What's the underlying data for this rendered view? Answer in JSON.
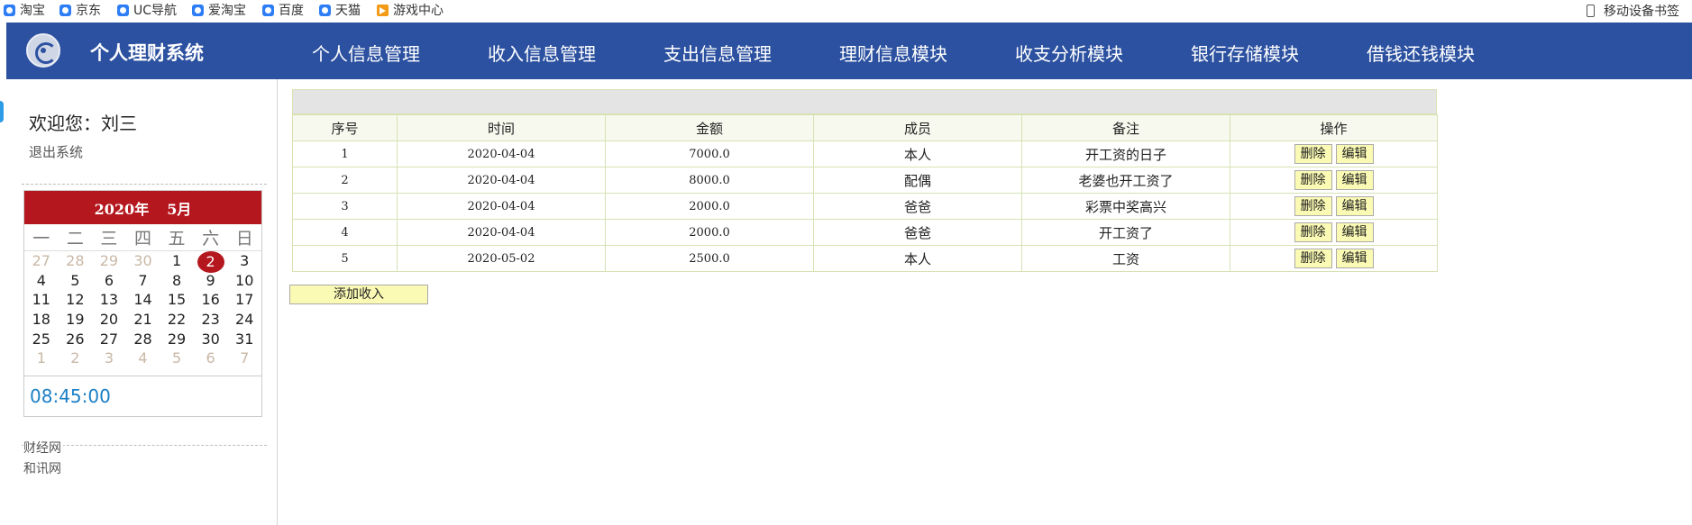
{
  "bookmarks": {
    "items": [
      {
        "label": "淘宝",
        "icon": "taobao-icon"
      },
      {
        "label": "京东",
        "icon": "jd-icon"
      },
      {
        "label": "UC导航",
        "icon": "uc-nav-icon"
      },
      {
        "label": "爱淘宝",
        "icon": "aitaobao-icon"
      },
      {
        "label": "百度",
        "icon": "baidu-icon"
      },
      {
        "label": "天猫",
        "icon": "tmall-icon"
      },
      {
        "label": "游戏中心",
        "icon": "game-center-icon"
      }
    ],
    "mobile": "移动设备书签"
  },
  "header": {
    "title": "个人理财系统",
    "nav": [
      "个人信息管理",
      "收入信息管理",
      "支出信息管理",
      "理财信息模块",
      "收支分析模块",
      "银行存储模块",
      "借钱还钱模块"
    ],
    "bg_color": "#2c51a0"
  },
  "sidebar": {
    "welcome": "欢迎您：刘三",
    "logout": "退出系统",
    "calendar": {
      "year": "2020年",
      "month": "5月",
      "weekdays": [
        "一",
        "二",
        "三",
        "四",
        "五",
        "六",
        "日"
      ],
      "days": [
        {
          "d": "27",
          "other": true
        },
        {
          "d": "28",
          "other": true
        },
        {
          "d": "29",
          "other": true
        },
        {
          "d": "30",
          "other": true
        },
        {
          "d": "1"
        },
        {
          "d": "2",
          "today": true
        },
        {
          "d": "3"
        },
        {
          "d": "4"
        },
        {
          "d": "5"
        },
        {
          "d": "6"
        },
        {
          "d": "7"
        },
        {
          "d": "8"
        },
        {
          "d": "9"
        },
        {
          "d": "10"
        },
        {
          "d": "11"
        },
        {
          "d": "12"
        },
        {
          "d": "13"
        },
        {
          "d": "14"
        },
        {
          "d": "15"
        },
        {
          "d": "16"
        },
        {
          "d": "17"
        },
        {
          "d": "18"
        },
        {
          "d": "19"
        },
        {
          "d": "20"
        },
        {
          "d": "21"
        },
        {
          "d": "22"
        },
        {
          "d": "23"
        },
        {
          "d": "24"
        },
        {
          "d": "25"
        },
        {
          "d": "26"
        },
        {
          "d": "27"
        },
        {
          "d": "28"
        },
        {
          "d": "29"
        },
        {
          "d": "30"
        },
        {
          "d": "31"
        },
        {
          "d": "1",
          "other": true
        },
        {
          "d": "2",
          "other": true
        },
        {
          "d": "3",
          "other": true
        },
        {
          "d": "4",
          "other": true
        },
        {
          "d": "5",
          "other": true
        },
        {
          "d": "6",
          "other": true
        },
        {
          "d": "7",
          "other": true
        }
      ],
      "time": "08:45:00",
      "accent_color": "#b5171e"
    },
    "links": [
      "财经网",
      "和讯网"
    ]
  },
  "table": {
    "headers": [
      "序号",
      "时间",
      "金额",
      "成员",
      "备注",
      "操作"
    ],
    "rows": [
      {
        "id": "1",
        "date": "2020-04-04",
        "amount": "7000.0",
        "member": "本人",
        "note": "开工资的日子"
      },
      {
        "id": "2",
        "date": "2020-04-04",
        "amount": "8000.0",
        "member": "配偶",
        "note": "老婆也开工资了"
      },
      {
        "id": "3",
        "date": "2020-04-04",
        "amount": "2000.0",
        "member": "爸爸",
        "note": "彩票中奖高兴"
      },
      {
        "id": "4",
        "date": "2020-04-04",
        "amount": "2000.0",
        "member": "爸爸",
        "note": "开工资了"
      },
      {
        "id": "5",
        "date": "2020-05-02",
        "amount": "2500.0",
        "member": "本人",
        "note": "工资"
      }
    ],
    "delete_label": "删除",
    "edit_label": "编辑",
    "button_color": "#fafab4"
  },
  "add_button": "添加收入"
}
